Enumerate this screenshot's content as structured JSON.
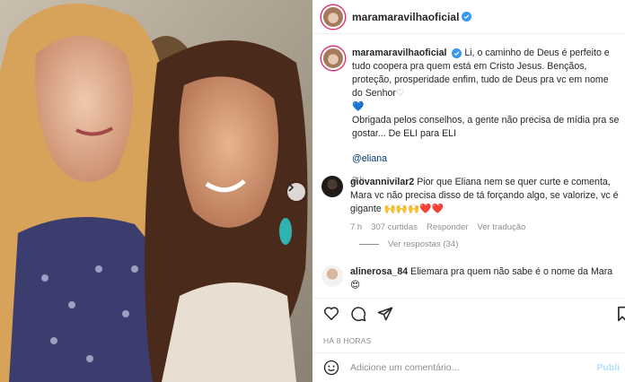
{
  "header": {
    "username": "maramaravilhaoficial"
  },
  "caption": {
    "username": "maramaravilhaoficial",
    "text_part1": "Li, o caminho de Deus é perfeito e tudo coopera pra quem está em Cristo Jesus. Bençãos, proteção, prosperidade enfim, tudo de Deus pra vc em nome do Senhor",
    "heart1": "♡",
    "heart2": "💙",
    "text_part2": "Obrigada pelos conselhos, a gente não precisa de mídia pra se gostar... De ELI para ELI",
    "mention": "@eliana",
    "time": "8 h"
  },
  "comments": [
    {
      "username": "giovannivilar2",
      "text": "Pior que Eliana nem se quer curte e comenta, Mara vc não precisa disso de tá forçando algo, se valorize, vc é gigante 🙌🙌🙌❤️❤️",
      "time": "7 h",
      "likes": "307 curtidas",
      "reply": "Responder",
      "translate": "Ver tradução"
    },
    {
      "username": "alinerosa_84",
      "text": "Eliemara pra quem não sabe é o nome da Mara 😍"
    }
  ],
  "view_replies": "Ver respostas (34)",
  "post_time": "HÁ 8 HORAS",
  "add_comment": {
    "placeholder": "Adicione um comentário...",
    "publish": "Publi"
  },
  "colors": {
    "accent": "#3897f0",
    "muted": "#8e8e8e",
    "mention": "#00376b",
    "heart": "#ed4956"
  }
}
